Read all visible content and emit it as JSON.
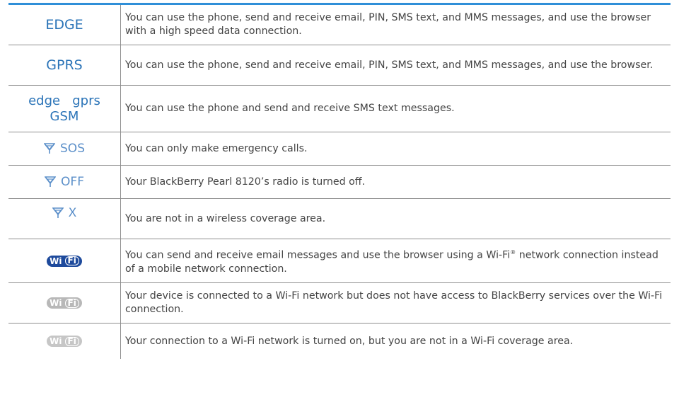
{
  "accent_color": "#2f8fd8",
  "rows": [
    {
      "icon": "EDGE",
      "description": "You can use the phone, send and receive email, PIN, SMS text, and MMS messages, and use the browser with a high speed data connection."
    },
    {
      "icon": "GPRS",
      "description": "You can use the phone, send and receive email, PIN, SMS text, and MMS messages, and use the browser."
    },
    {
      "icon_line1": "edge   gprs",
      "icon_line2": "GSM",
      "description": "You can use the phone and send and receive SMS text messages."
    },
    {
      "icon_text": "SOS",
      "icon_name": "signal-antenna-icon",
      "description": "You can only make emergency calls."
    },
    {
      "icon_text": "OFF",
      "icon_name": "signal-antenna-icon",
      "description": "Your BlackBerry Pearl 8120’s radio is turned off."
    },
    {
      "icon_text": "X",
      "icon_name": "signal-antenna-icon",
      "description": "You are not in a wireless coverage area."
    },
    {
      "icon_wi": "Wi",
      "icon_fi": "Fi",
      "icon_name": "wifi-connected-icon",
      "description_a": "You can send and receive email messages and use the browser using a Wi-Fi",
      "description_sup": "®",
      "description_b": " network connection instead of a mobile network connection."
    },
    {
      "icon_wi": "Wi",
      "icon_fi": "Fi",
      "icon_name": "wifi-no-services-icon",
      "description": "Your device is connected to a Wi-Fi network but does not have access to BlackBerry services over the Wi-Fi connection."
    },
    {
      "icon_wi": "Wi",
      "icon_fi": "Fi",
      "icon_name": "wifi-no-coverage-icon",
      "description": "Your connection to a Wi-Fi network is turned on, but you are not in a Wi-Fi coverage area."
    }
  ]
}
